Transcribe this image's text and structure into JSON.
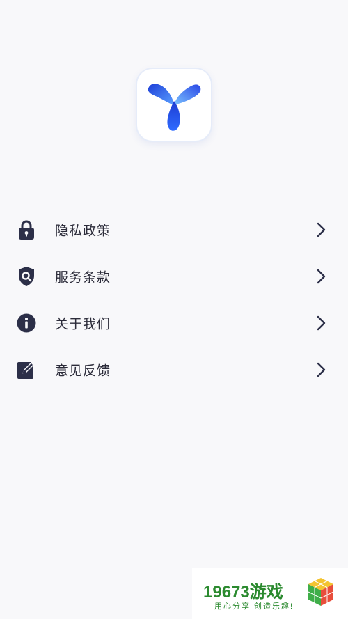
{
  "menu": {
    "items": [
      {
        "label": "隐私政策",
        "icon": "lock-icon"
      },
      {
        "label": "服务条款",
        "icon": "shield-search-icon"
      },
      {
        "label": "关于我们",
        "icon": "info-icon"
      },
      {
        "label": "意见反馈",
        "icon": "edit-icon"
      }
    ]
  },
  "watermark": {
    "brand": "19673游戏",
    "slogan": "用心分享 创造乐趣!"
  },
  "colors": {
    "background": "#f8f8fa",
    "icon": "#2c2f48",
    "logo_blue": "#3b5df0",
    "watermark_green": "#2b8a2f"
  }
}
